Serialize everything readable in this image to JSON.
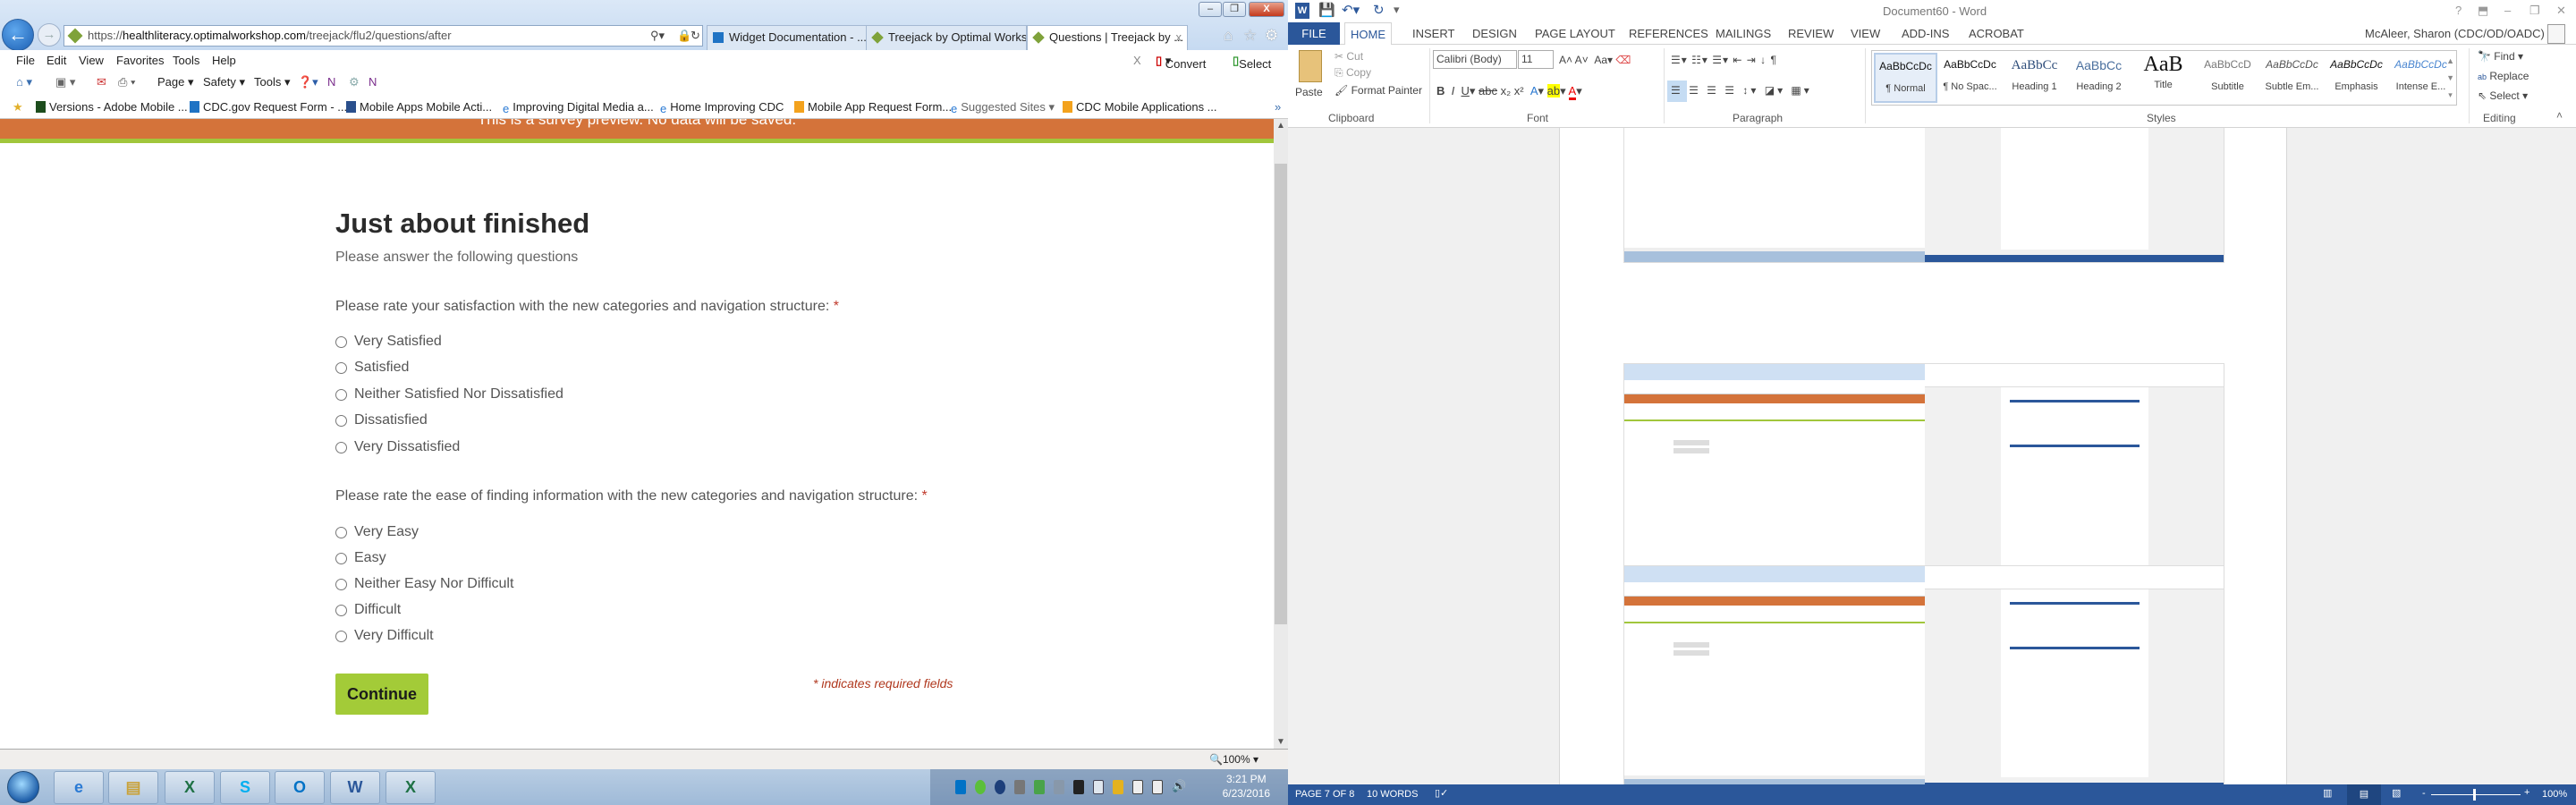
{
  "browser": {
    "window_controls": {
      "minimize": "–",
      "restore": "❐",
      "close": "X"
    },
    "url": {
      "scheme": "https://",
      "host": "healthliteracy.optimalworkshop.com",
      "path": "/treejack/flu2/questions/after"
    },
    "tabs": [
      {
        "label": "Widget Documentation - ..."
      },
      {
        "label": "Treejack by Optimal Works..."
      },
      {
        "label": "Questions | Treejack by ..."
      }
    ],
    "menu": [
      "File",
      "Edit",
      "View",
      "Favorites",
      "Tools",
      "Help"
    ],
    "menu_right": {
      "close": "X",
      "convert": "Convert",
      "select": "Select"
    },
    "command_bar": {
      "page": "Page ▾",
      "safety": "Safety ▾",
      "tools": "Tools ▾"
    },
    "favorites": [
      "Versions - Adobe Mobile ...",
      "CDC.gov Request Form - ...",
      "Mobile Apps  Mobile Acti...",
      "Improving Digital Media a...",
      "Home  Improving CDC",
      "Mobile App Request Form...",
      "Suggested Sites ▾",
      "CDC Mobile Applications ..."
    ],
    "favorites_more": "»",
    "banner": "This is a survey preview. No data will be saved.",
    "survey": {
      "title": "Just about finished",
      "subtitle": "Please answer the following questions",
      "questions": [
        {
          "text": "Please rate your satisfaction with the new categories and navigation structure:",
          "required": "*",
          "options": [
            "Very Satisfied",
            "Satisfied",
            "Neither Satisfied Nor Dissatisfied",
            "Dissatisfied",
            "Very Dissatisfied"
          ]
        },
        {
          "text": "Please rate the ease of finding information with the new categories and navigation structure:",
          "required": "*",
          "options": [
            "Very Easy",
            "Easy",
            "Neither Easy Nor Difficult",
            "Difficult",
            "Very Difficult"
          ]
        }
      ],
      "continue_label": "Continue",
      "required_note": "* indicates required fields"
    },
    "zoom": "100%"
  },
  "taskbar": {
    "apps": [
      "Internet Explorer",
      "File Explorer",
      "Excel",
      "Skype",
      "Outlook",
      "Word",
      "Excel"
    ],
    "app_glyphs": [
      "e",
      "▤",
      "X",
      "S",
      "O",
      "W",
      "X"
    ],
    "time": "3:21 PM",
    "date": "6/23/2016"
  },
  "word": {
    "title": "Document60 - Word",
    "title_controls": {
      "help": "?",
      "ribbon": "⬒",
      "min": "–",
      "restore": "❐",
      "close": "✕"
    },
    "tabs": [
      "FILE",
      "HOME",
      "INSERT",
      "DESIGN",
      "PAGE LAYOUT",
      "REFERENCES",
      "MAILINGS",
      "REVIEW",
      "VIEW",
      "ADD-INS",
      "ACROBAT"
    ],
    "user": "McAleer, Sharon (CDC/OD/OADC) ▾",
    "clipboard": {
      "paste": "Paste",
      "cut": "Cut",
      "copy": "Copy",
      "format_painter": "Format Painter",
      "label": "Clipboard"
    },
    "font": {
      "name": "Calibri (Body)",
      "size": "11",
      "label": "Font"
    },
    "paragraph": {
      "label": "Paragraph"
    },
    "styles": {
      "label": "Styles",
      "items": [
        {
          "preview": "AaBbCcDc",
          "name": "¶ Normal"
        },
        {
          "preview": "AaBbCcDc",
          "name": "¶ No Spac..."
        },
        {
          "preview": "AaBbCc",
          "name": "Heading 1"
        },
        {
          "preview": "AaBbCc",
          "name": "Heading 2"
        },
        {
          "preview": "AaB",
          "name": "Title"
        },
        {
          "preview": "AaBbCcD",
          "name": "Subtitle"
        },
        {
          "preview": "AaBbCcDc",
          "name": "Subtle Em..."
        },
        {
          "preview": "AaBbCcDc",
          "name": "Emphasis"
        },
        {
          "preview": "AaBbCcDc",
          "name": "Intense E..."
        }
      ]
    },
    "editing": {
      "find": "Find ▾",
      "replace": "Replace",
      "select": "Select ▾",
      "label": "Editing"
    },
    "status": {
      "page": "PAGE 7 OF 8",
      "words": "10 WORDS",
      "zoom": "100%"
    }
  },
  "colors": {
    "banner": "#d4733a",
    "accent_green": "#a3cb38",
    "word_blue": "#2b579a",
    "required": "#c0392b"
  }
}
